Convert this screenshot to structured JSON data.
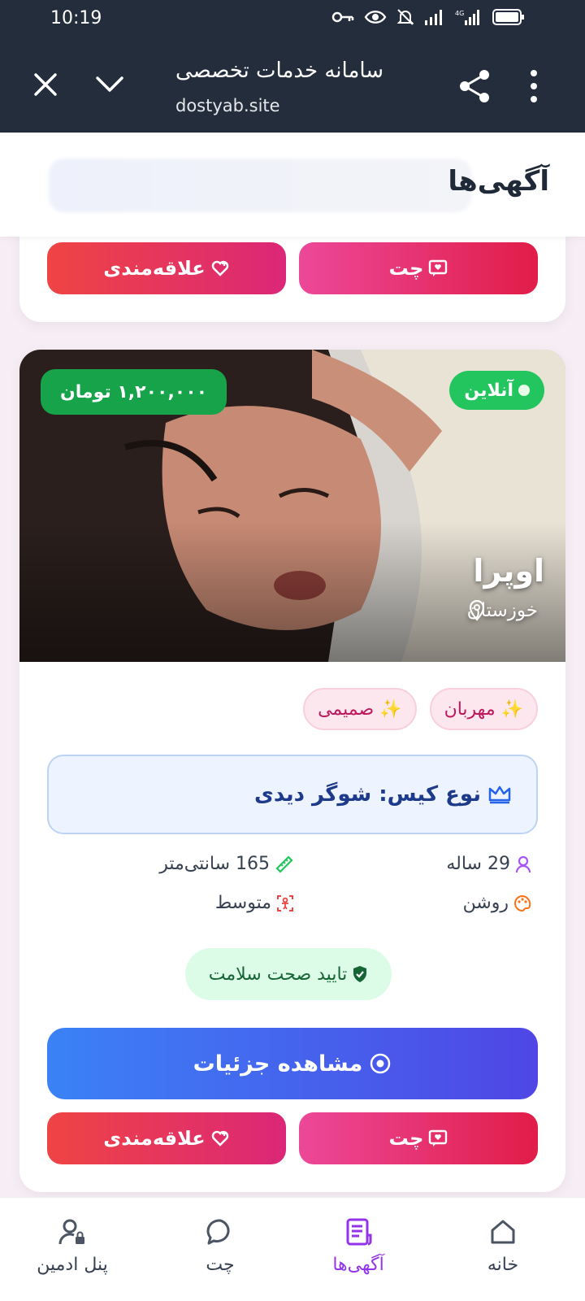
{
  "status_bar": {
    "time": "10:19"
  },
  "browser": {
    "title": "سامانه خدمات تخصصی",
    "url": "dostyab.site",
    "icons": [
      "close-icon",
      "chevron-down-icon",
      "share-icon",
      "more-vertical-icon"
    ]
  },
  "header": {
    "title": "آگهی‌ها"
  },
  "prev_card": {
    "chat_label": "چت",
    "favorite_label": "علاقه‌مندی"
  },
  "card": {
    "online_label": "آنلاین",
    "price": "۱,۲۰۰,۰۰۰ تومان",
    "name": "اوپرا",
    "location": "خوزستان",
    "tags": [
      "✨ مهربان",
      "✨ صمیمی"
    ],
    "case_type": "نوع کیس: شوگر دیدی",
    "age": "29 ساله",
    "height": "165 سانتی‌متر",
    "skin": "روشن",
    "body": "متوسط",
    "health": "تایید صحت سلامت",
    "details_label": "مشاهده جزئیات",
    "chat_label": "چت",
    "favorite_label": "علاقه‌مندی"
  },
  "nav": {
    "home": "خانه",
    "ads": "آگهی‌ها",
    "chat": "چت",
    "admin": "پنل ادمین",
    "active": "ads"
  },
  "colors": {
    "accent": "#9333ea",
    "online": "#22c55e",
    "details_start": "#3b82f6",
    "details_end": "#4f46e5"
  }
}
